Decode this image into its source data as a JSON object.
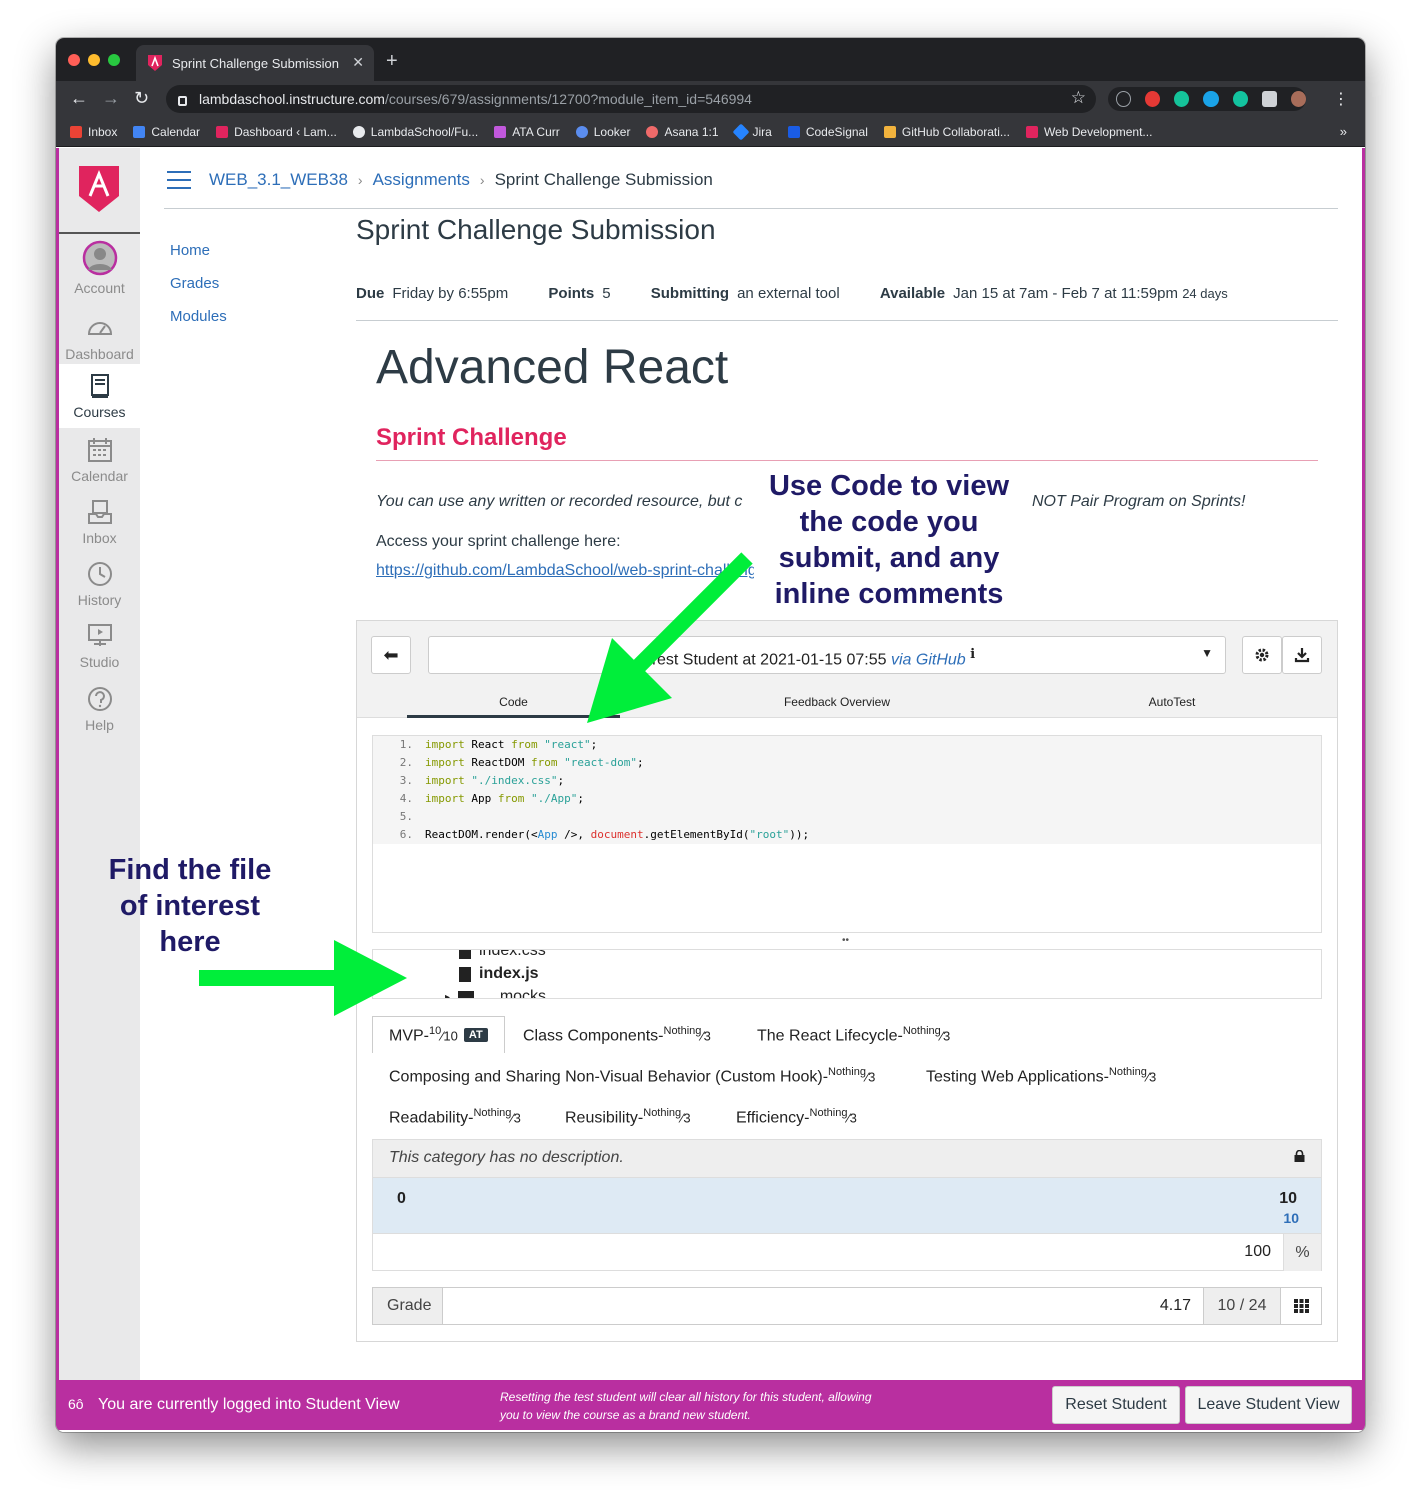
{
  "browser": {
    "tab_title": "Sprint Challenge Submission",
    "new_tab": "+",
    "tab_close": "✕",
    "url_host": "lambdaschool.instructure.com",
    "url_path": "/courses/679/assignments/12700?module_item_id=546994",
    "bookmarks": [
      "Inbox",
      "Calendar",
      "Dashboard ‹ Lam...",
      "LambdaSchool/Fu...",
      "ATA Curr",
      "Looker",
      "Asana 1:1",
      "Jira",
      "CodeSignal",
      "GitHub Collaborati...",
      "Web Development..."
    ],
    "bookmarks_more": "»"
  },
  "global_nav": {
    "items": [
      {
        "label": "Account",
        "icon": "account-avatar-icon"
      },
      {
        "label": "Dashboard",
        "icon": "dashboard-icon"
      },
      {
        "label": "Courses",
        "icon": "courses-icon"
      },
      {
        "label": "Calendar",
        "icon": "calendar-icon"
      },
      {
        "label": "Inbox",
        "icon": "inbox-icon"
      },
      {
        "label": "History",
        "icon": "history-icon"
      },
      {
        "label": "Studio",
        "icon": "studio-icon"
      },
      {
        "label": "Help",
        "icon": "help-icon"
      }
    ]
  },
  "breadcrumb": {
    "course": "WEB_3.1_WEB38",
    "section": "Assignments",
    "current": "Sprint Challenge Submission"
  },
  "course_nav": [
    "Home",
    "Grades",
    "Modules"
  ],
  "assignment": {
    "title": "Sprint Challenge Submission",
    "due_label": "Due",
    "due_value": "Friday by 6:55pm",
    "points_label": "Points",
    "points_value": "5",
    "submitting_label": "Submitting",
    "submitting_value": "an external tool",
    "available_label": "Available",
    "available_value": "Jan 15 at 7am - Feb 7 at 11:59pm",
    "available_days": "24 days"
  },
  "content": {
    "heading": "Advanced React",
    "subheading": "Sprint Challenge",
    "italic_left": "You can use any written or recorded resource, but c",
    "italic_right": "NOT Pair Program on Sprints!",
    "access_text": "Access your sprint challenge here:",
    "repo_link": "https://github.com/LambdaSchool/web-sprint-challenge-advanced-react"
  },
  "annotations": {
    "code_note": "Use Code to view the code you submit, and any inline comments",
    "file_note": "Find the file of interest here"
  },
  "grader": {
    "submission_prefix": "Test Student at 2021-01-15 07:55",
    "submission_via": "via",
    "submission_source": "GitHub",
    "info_mark": "ℹ",
    "tabs": [
      "Code",
      "Feedback Overview",
      "AutoTest"
    ],
    "code_lines": [
      {
        "n": "1.",
        "text": "import React from \"react\";"
      },
      {
        "n": "2.",
        "text": "import ReactDOM from \"react-dom\";"
      },
      {
        "n": "3.",
        "text": "import \"./index.css\";"
      },
      {
        "n": "4.",
        "text": "import App from \"./App\";"
      },
      {
        "n": "5.",
        "text": ""
      },
      {
        "n": "6.",
        "text": "ReactDOM.render(<App />, document.getElementById(\"root\"));"
      }
    ],
    "resize_grip": "••",
    "files": [
      "index.css",
      "index.js",
      "__mocks__"
    ],
    "rubric_tabs": [
      {
        "name": "MVP-",
        "num": "10",
        "den": "10",
        "badge": "AT"
      },
      {
        "name": "Class Components-",
        "num": "Nothing",
        "den": "3"
      },
      {
        "name": "The React Lifecycle-",
        "num": "Nothing",
        "den": "3"
      },
      {
        "name": "Composing and Sharing Non-Visual Behavior (Custom Hook)-",
        "num": "Nothing",
        "den": "3"
      },
      {
        "name": "Testing Web Applications-",
        "num": "Nothing",
        "den": "3"
      },
      {
        "name": "Readability-",
        "num": "Nothing",
        "den": "3"
      },
      {
        "name": "Reusibility-",
        "num": "Nothing",
        "den": "3"
      },
      {
        "name": "Efficiency-",
        "num": "Nothing",
        "den": "3"
      }
    ],
    "category_description": "This category has no description.",
    "scale_min": "0",
    "scale_max": "10",
    "scale_selected": "10",
    "percentage": "100",
    "percent_sign": "%",
    "grade_label": "Grade",
    "grade_value": "4.17",
    "grade_fraction": "10 / 24"
  },
  "student_view": {
    "message": "You are currently logged into Student View",
    "note_line1": "Resetting the test student will clear all history for this student, allowing",
    "note_line2": "you to view the course as a brand new student.",
    "reset_label": "Reset Student",
    "leave_label": "Leave Student View"
  },
  "colors": {
    "canvas_pink": "#b92fa0",
    "link_blue": "#2d6eb8",
    "heading_red": "#e0245e",
    "annotation_navy": "#1f1a66",
    "arrow_green": "#00ee3a"
  }
}
